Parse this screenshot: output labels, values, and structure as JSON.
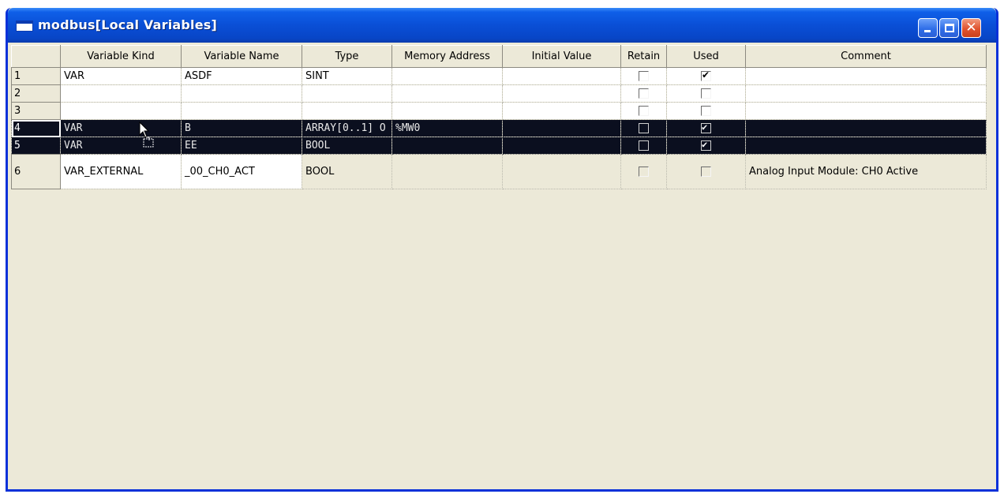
{
  "window": {
    "title": "modbus[Local Variables]"
  },
  "grid": {
    "headers": [
      "",
      "Variable Kind",
      "Variable Name",
      "Type",
      "Memory Address",
      "Initial Value",
      "Retain",
      "Used",
      "Comment"
    ],
    "rows": [
      {
        "num": "1",
        "kind": "VAR",
        "name": "ASDF",
        "type": "SINT",
        "address": "",
        "initial": "",
        "retain": false,
        "used": true,
        "comment": ""
      },
      {
        "num": "2",
        "kind": "",
        "name": "",
        "type": "",
        "address": "",
        "initial": "",
        "retain": false,
        "used": false,
        "comment": ""
      },
      {
        "num": "3",
        "kind": "",
        "name": "",
        "type": "",
        "address": "",
        "initial": "",
        "retain": false,
        "used": false,
        "comment": ""
      },
      {
        "num": "4",
        "kind": "VAR",
        "name": "B",
        "type": "ARRAY[0..1] O",
        "address": "%MW0",
        "initial": "",
        "retain": false,
        "used": true,
        "comment": ""
      },
      {
        "num": "5",
        "kind": "VAR",
        "name": "EE",
        "type": "BOOL",
        "address": "",
        "initial": "",
        "retain": false,
        "used": true,
        "comment": ""
      },
      {
        "num": "6",
        "kind": "VAR_EXTERNAL",
        "name": "_00_CH0_ACT",
        "type": "BOOL",
        "address": "",
        "initial": "",
        "retain": false,
        "used": false,
        "comment": "Analog Input Module: CH0 Active"
      }
    ]
  },
  "colors": {
    "titlebar": "#0a4fd6",
    "selection": "#0b0f1f",
    "window_bg": "#ece9d8"
  }
}
